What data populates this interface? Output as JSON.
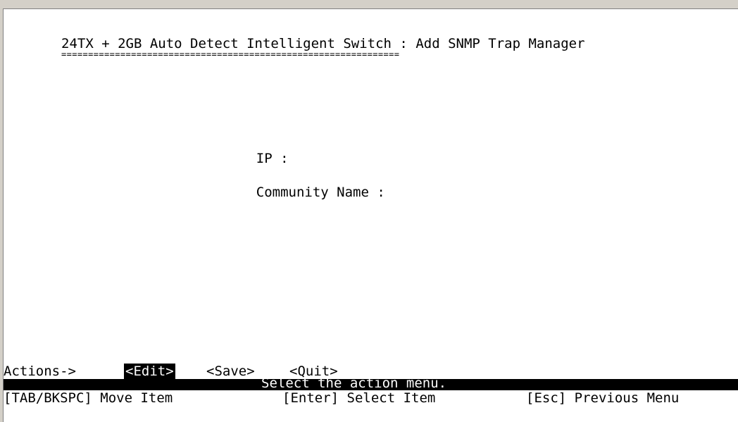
{
  "screen": {
    "title": "24TX + 2GB Auto Detect Intelligent Switch : Add SNMP Trap Manager",
    "title_underline": "==============================================================="
  },
  "form": {
    "ip_label": "IP :",
    "ip_value": "",
    "community_label": "Community Name :",
    "community_value": ""
  },
  "actions": {
    "label": "Actions->",
    "items": [
      {
        "label": "<Edit>",
        "selected": true
      },
      {
        "label": "<Save>",
        "selected": false
      },
      {
        "label": "<Quit>",
        "selected": false
      }
    ]
  },
  "status": {
    "message": "Select the action menu."
  },
  "help": {
    "tab": "[TAB/BKSPC] Move Item",
    "enter": "[Enter] Select Item",
    "esc": "[Esc] Previous Menu"
  },
  "colors": {
    "background": "#ffffff",
    "text": "#000000",
    "highlight_bg": "#000000",
    "highlight_text": "#ffffff",
    "frame": "#d4d0c8"
  }
}
